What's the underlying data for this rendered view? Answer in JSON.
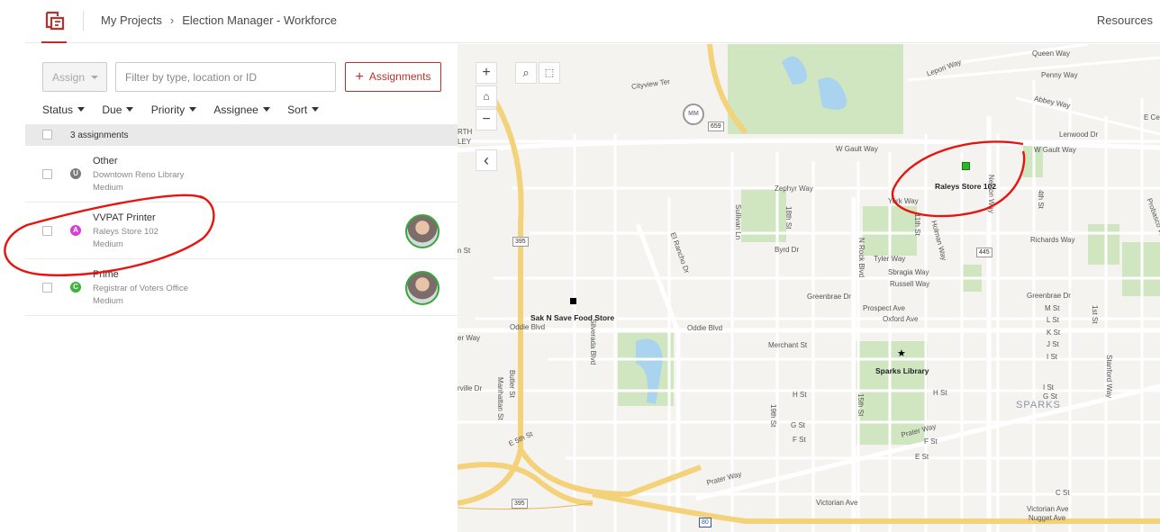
{
  "header": {
    "breadcrumb": [
      "My Projects",
      "Election Manager - Workforce"
    ],
    "separator": "›",
    "resources_label": "Resources"
  },
  "toolbar": {
    "assign_label": "Assign",
    "filter_placeholder": "Filter by type, location or ID",
    "add_button_label": "Assignments"
  },
  "sorts": [
    "Status",
    "Due",
    "Priority",
    "Assignee",
    "Sort"
  ],
  "list": {
    "count_label": "3 assignments",
    "rows": [
      {
        "type": "Other",
        "location": "Downtown Reno Library",
        "priority": "Medium",
        "badge": "U",
        "badge_color": "#7a7a7a",
        "assigned": false
      },
      {
        "type": "VVPAT Printer",
        "location": "Raleys Store 102",
        "priority": "Medium",
        "badge": "A",
        "badge_color": "#d43fd6",
        "assigned": true
      },
      {
        "type": "Prime",
        "location": "Registrar of Voters Office",
        "priority": "Medium",
        "badge": "C",
        "badge_color": "#3db339",
        "assigned": true
      }
    ]
  },
  "map": {
    "zoom_in": "+",
    "zoom_out": "−",
    "home_icon": "home-icon",
    "collapse": "‹",
    "pois": [
      "Raleys Store 102",
      "Sak N Save Food Store",
      "Sparks Library"
    ],
    "place_label": "SPARKS",
    "streets": [
      "Queen Way",
      "Penny Way",
      "Abbey Way",
      "E Ce",
      "Lenwood Dr",
      "W Gault Way",
      "W Gault Way",
      "Zephyr Way",
      "York Way",
      "Byrd Dr",
      "Tyler Way",
      "Sbragia Way",
      "Russell Way",
      "Richards Way",
      "Greenbrae Dr",
      "Greenbrae Dr",
      "Prospect Ave",
      "Oxford Ave",
      "M St",
      "L St",
      "K St",
      "J St",
      "I St",
      "Oddie Blvd",
      "Oddie Blvd",
      "Merchant St",
      "I St",
      "H St",
      "G St",
      "F St",
      "H St",
      "G St",
      "F St",
      "Prater Way",
      "Prater Way",
      "E St",
      "C St",
      "Victorian Ave",
      "Victorian Ave",
      "Nugget Ave",
      "Cityview Ter",
      "Lepori Way",
      "er Way",
      "rville Dr",
      "n St",
      "RTH",
      "LEY",
      "Silverada Blvd",
      "Butler St",
      "Manhattan St",
      "El Rancho Dr",
      "Sullivan Ln",
      "18th St",
      "N Rock Blvd",
      "11th St",
      "Holman Way",
      "Nelson Way",
      "4th St",
      "1st St",
      "Probasco Way",
      "Stanford Way",
      "19th St",
      "15th St",
      "E 5th St"
    ],
    "shields": [
      "659",
      "395",
      "395",
      "445",
      "80",
      "MM"
    ]
  }
}
